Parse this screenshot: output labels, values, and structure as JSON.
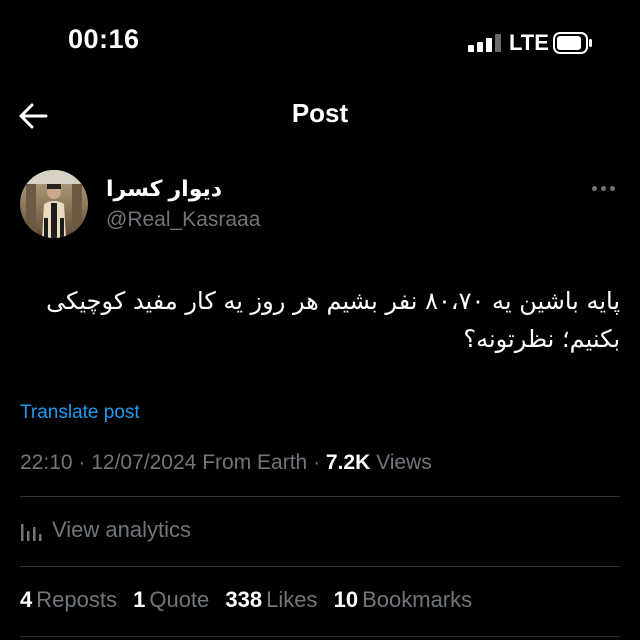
{
  "status_bar": {
    "time": "00:16",
    "network": "LTE",
    "signal_bars": 4,
    "signal_bars_active": 3
  },
  "header": {
    "title": "Post",
    "back_icon": "arrow-left-icon"
  },
  "post": {
    "author": {
      "display_name": "دیوار کسرا",
      "handle": "@Real_Kasraaa"
    },
    "text_lines": [
      "پایه باشین یه ۸۰،۷۰ نفر بشیم هر روز یه کار مفید کوچیکی",
      "بکنیم؛ نظرتونه؟"
    ],
    "translate_label": "Translate post",
    "meta": {
      "time": "22:10",
      "date": "12/07/2024",
      "source": "From Earth",
      "views_count": "7.2K",
      "views_label": "Views"
    },
    "analytics_label": "View analytics",
    "stats": [
      {
        "count": "4",
        "label": "Reposts"
      },
      {
        "count": "1",
        "label": "Quote"
      },
      {
        "count": "338",
        "label": "Likes"
      },
      {
        "count": "10",
        "label": "Bookmarks"
      }
    ]
  },
  "colors": {
    "background": "#000000",
    "text_primary": "#ffffff",
    "text_secondary": "#71767b",
    "link": "#1d9bf0",
    "divider": "#2f3336"
  }
}
